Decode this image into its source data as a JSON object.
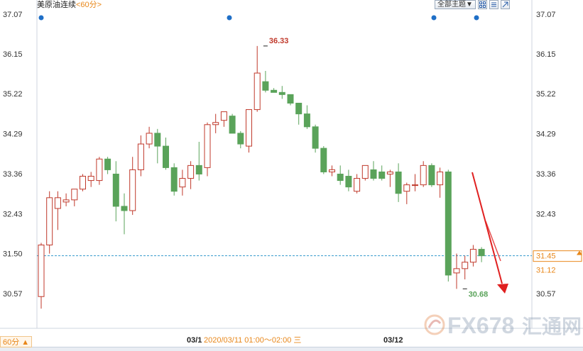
{
  "header": {
    "symbol": "美原油连续",
    "period": "<60分>"
  },
  "toolbar": {
    "theme_label": "全部主题▼"
  },
  "period_tag": "60分 ▲",
  "watermark": {
    "text": "FX678",
    "cn": "汇通网"
  },
  "colors": {
    "up": "#c0392b",
    "down": "#5aa35a",
    "accent": "#e8871a",
    "arrow": "#e02020",
    "ref_line": "#3399cc"
  },
  "chart_data": {
    "type": "candlestick",
    "title": "",
    "ylim": [
      30.1,
      37.2
    ],
    "y_ticks": [
      "37.07",
      "36.15",
      "35.22",
      "34.29",
      "33.36",
      "32.43",
      "31.50",
      "30.57"
    ],
    "x_ticks": [
      "03/1",
      "03/12"
    ],
    "crosshair_label": "2020/03/11 01:00～02:00 三",
    "last_price": 31.45,
    "right_labels": [
      "31.45",
      "31.12"
    ],
    "reference_line": 31.45,
    "annotations": [
      {
        "text": "36.33",
        "value": 36.33,
        "index": 27,
        "dir": "up"
      },
      {
        "text": "30.68",
        "value": 30.68,
        "index": 51,
        "dir": "down"
      }
    ],
    "candles": [
      {
        "o": 30.5,
        "h": 31.75,
        "l": 30.22,
        "c": 31.7
      },
      {
        "o": 31.7,
        "h": 32.95,
        "l": 31.5,
        "c": 32.8
      },
      {
        "o": 32.55,
        "h": 32.95,
        "l": 32.05,
        "c": 32.8
      },
      {
        "o": 32.7,
        "h": 32.9,
        "l": 32.6,
        "c": 32.75
      },
      {
        "o": 32.75,
        "h": 33.0,
        "l": 32.6,
        "c": 33.0
      },
      {
        "o": 33.0,
        "h": 33.35,
        "l": 32.95,
        "c": 33.3
      },
      {
        "o": 33.2,
        "h": 33.4,
        "l": 33.05,
        "c": 33.3
      },
      {
        "o": 33.2,
        "h": 33.75,
        "l": 33.1,
        "c": 33.7
      },
      {
        "o": 33.7,
        "h": 33.75,
        "l": 33.35,
        "c": 33.45
      },
      {
        "o": 33.35,
        "h": 33.65,
        "l": 32.25,
        "c": 32.6
      },
      {
        "o": 32.6,
        "h": 32.9,
        "l": 31.95,
        "c": 32.5
      },
      {
        "o": 32.5,
        "h": 33.75,
        "l": 32.4,
        "c": 33.45
      },
      {
        "o": 33.45,
        "h": 34.25,
        "l": 33.3,
        "c": 34.05
      },
      {
        "o": 34.05,
        "h": 34.45,
        "l": 33.95,
        "c": 34.3
      },
      {
        "o": 34.3,
        "h": 34.4,
        "l": 33.6,
        "c": 34.0
      },
      {
        "o": 34.0,
        "h": 34.2,
        "l": 33.45,
        "c": 33.5
      },
      {
        "o": 33.5,
        "h": 33.6,
        "l": 32.85,
        "c": 32.95
      },
      {
        "o": 33.05,
        "h": 33.45,
        "l": 32.85,
        "c": 33.25
      },
      {
        "o": 33.25,
        "h": 33.65,
        "l": 33.0,
        "c": 33.55
      },
      {
        "o": 33.55,
        "h": 34.1,
        "l": 33.2,
        "c": 33.35
      },
      {
        "o": 33.5,
        "h": 34.55,
        "l": 33.3,
        "c": 34.5
      },
      {
        "o": 34.5,
        "h": 34.75,
        "l": 34.3,
        "c": 34.55
      },
      {
        "o": 34.6,
        "h": 34.8,
        "l": 34.45,
        "c": 34.8
      },
      {
        "o": 34.7,
        "h": 34.75,
        "l": 34.3,
        "c": 34.3
      },
      {
        "o": 34.3,
        "h": 34.35,
        "l": 33.95,
        "c": 34.05
      },
      {
        "o": 34.0,
        "h": 34.85,
        "l": 33.85,
        "c": 34.85
      },
      {
        "o": 34.85,
        "h": 36.33,
        "l": 34.8,
        "c": 35.7
      },
      {
        "o": 35.5,
        "h": 35.75,
        "l": 35.25,
        "c": 35.3
      },
      {
        "o": 35.3,
        "h": 35.35,
        "l": 35.25,
        "c": 35.25
      },
      {
        "o": 35.25,
        "h": 35.4,
        "l": 35.1,
        "c": 35.2
      },
      {
        "o": 35.2,
        "h": 35.2,
        "l": 34.95,
        "c": 35.0
      },
      {
        "o": 35.0,
        "h": 35.0,
        "l": 34.5,
        "c": 34.75
      },
      {
        "o": 34.75,
        "h": 34.95,
        "l": 34.4,
        "c": 34.45
      },
      {
        "o": 34.45,
        "h": 34.5,
        "l": 33.85,
        "c": 33.95
      },
      {
        "o": 33.95,
        "h": 34.0,
        "l": 33.35,
        "c": 33.4
      },
      {
        "o": 33.4,
        "h": 33.55,
        "l": 33.3,
        "c": 33.45
      },
      {
        "o": 33.35,
        "h": 33.55,
        "l": 33.1,
        "c": 33.2
      },
      {
        "o": 33.3,
        "h": 33.45,
        "l": 32.95,
        "c": 33.05
      },
      {
        "o": 32.95,
        "h": 33.35,
        "l": 32.9,
        "c": 33.25
      },
      {
        "o": 33.25,
        "h": 33.55,
        "l": 33.2,
        "c": 33.55
      },
      {
        "o": 33.45,
        "h": 33.65,
        "l": 33.2,
        "c": 33.25
      },
      {
        "o": 33.4,
        "h": 33.55,
        "l": 33.2,
        "c": 33.25
      },
      {
        "o": 33.35,
        "h": 33.45,
        "l": 33.05,
        "c": 33.4
      },
      {
        "o": 33.4,
        "h": 33.6,
        "l": 32.7,
        "c": 32.9
      },
      {
        "o": 32.95,
        "h": 33.15,
        "l": 32.65,
        "c": 33.1
      },
      {
        "o": 33.1,
        "h": 33.35,
        "l": 32.95,
        "c": 33.1
      },
      {
        "o": 33.1,
        "h": 33.65,
        "l": 33.05,
        "c": 33.55
      },
      {
        "o": 33.55,
        "h": 33.6,
        "l": 33.05,
        "c": 33.1
      },
      {
        "o": 33.1,
        "h": 33.5,
        "l": 32.8,
        "c": 33.4
      },
      {
        "o": 33.4,
        "h": 33.45,
        "l": 30.85,
        "c": 31.0
      },
      {
        "o": 31.05,
        "h": 31.5,
        "l": 30.68,
        "c": 31.15
      },
      {
        "o": 31.15,
        "h": 31.45,
        "l": 30.9,
        "c": 31.3
      },
      {
        "o": 31.3,
        "h": 31.7,
        "l": 31.2,
        "c": 31.6
      },
      {
        "o": 31.6,
        "h": 31.65,
        "l": 31.3,
        "c": 31.45
      }
    ]
  }
}
